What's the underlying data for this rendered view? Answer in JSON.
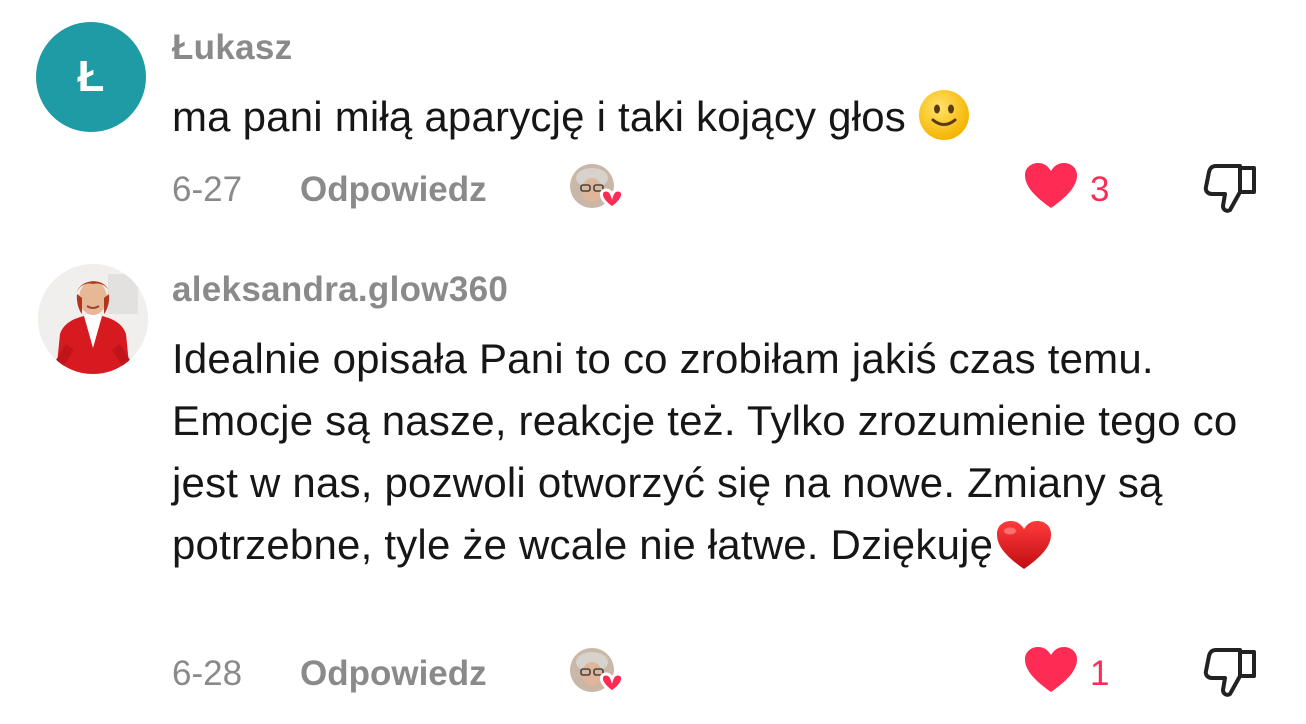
{
  "comments": [
    {
      "avatar_letter": "Ł",
      "avatar_color": "#1f9ba5",
      "username": "Łukasz",
      "text": "ma pani miłą aparycję i taki kojący głos",
      "emoji": "slightly-smiling-face",
      "date": "6-27",
      "reply_label": "Odpowiedz",
      "likes": "3",
      "liked_by_creator": true
    },
    {
      "avatar_letter": "",
      "username": "aleksandra.glow360",
      "text": "Idealnie opisała Pani to co zrobiłam jakiś czas temu. Emocje są nasze, reakcje też. Tylko zrozumienie tego co jest w nas, pozwoli otworzyć się na nowe. Zmiany są potrzebne, tyle że wcale nie łatwe. Dziękuję",
      "emoji": "red-heart",
      "date": "6-28",
      "reply_label": "Odpowiedz",
      "likes": "1",
      "liked_by_creator": true
    }
  ],
  "colors": {
    "like_red": "#fe2c55",
    "meta_gray": "#8a8a8a",
    "text": "#161616"
  }
}
